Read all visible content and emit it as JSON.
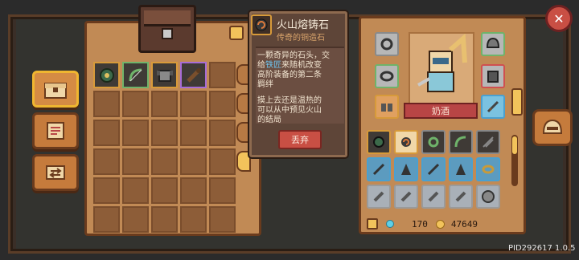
{
  "tooltip": {
    "title": "火山熔铸石",
    "subtitle": "传奇的铜造石",
    "text_1_pre": "一颗奇异的石头，交",
    "text_1_b": "给",
    "text_1_hl": "铁匠",
    "text_1_post": "来随机改变",
    "text_2": "高阶装备的第二条",
    "text_3": "羁绊",
    "text_4": "摸上去还是温热的",
    "text_5": "可以从中预见火山",
    "text_6": "的结局",
    "discard_label": "丢弃"
  },
  "character": {
    "name": "奶酒"
  },
  "currency": {
    "gems": "170",
    "coins": "47649"
  },
  "version": "PID292617 1.0.5",
  "storage": {
    "items": [
      {
        "name": "amulet-item-icon",
        "rarity": "orange"
      },
      {
        "name": "bow-item-icon",
        "rarity": "green"
      },
      {
        "name": "chest-armor-item-icon",
        "rarity": "orange"
      },
      {
        "name": "club-item-icon",
        "rarity": "purple"
      }
    ],
    "total_slots": 30
  },
  "colors": {
    "wood": "#c18a55",
    "accent": "#f2c35b",
    "danger": "#c94f44",
    "highlight": "#6dc3ee"
  }
}
